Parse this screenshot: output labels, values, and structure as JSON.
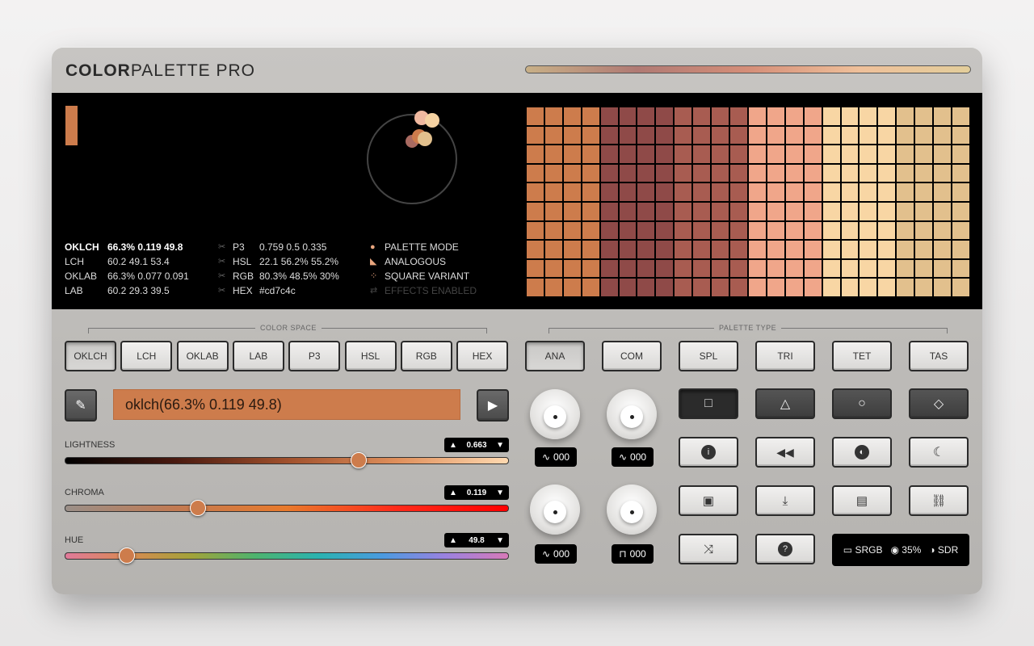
{
  "app": {
    "title_bold": "COLOR",
    "title_light": "PALETTE PRO"
  },
  "colors": {
    "primary": "#cd7c4c"
  },
  "wheel_dots": [
    {
      "color": "#f0b9a0"
    },
    {
      "color": "#f5d2a2"
    },
    {
      "color": "#a96a61"
    },
    {
      "color": "#cd7c4c"
    },
    {
      "color": "#e2c08d"
    }
  ],
  "info": {
    "oklch": {
      "label": "OKLCH",
      "value": "66.3% 0.119 49.8"
    },
    "lch": {
      "label": "LCH",
      "value": "60.2 49.1 53.4"
    },
    "oklab": {
      "label": "OKLAB",
      "value": "66.3% 0.077 0.091"
    },
    "lab": {
      "label": "LAB",
      "value": "60.2 29.3 39.5"
    },
    "p3": {
      "label": "P3",
      "value": "0.759 0.5 0.335"
    },
    "hsl": {
      "label": "HSL",
      "value": "22.1 56.2% 55.2%"
    },
    "rgb": {
      "label": "RGB",
      "value": "80.3% 48.5% 30%"
    },
    "hex": {
      "label": "HEX",
      "value": "#cd7c4c"
    },
    "modes": [
      {
        "label": "PALETTE MODE",
        "icon": "palette-icon"
      },
      {
        "label": "ANALOGOUS",
        "icon": "analogous-icon"
      },
      {
        "label": "SQUARE VARIANT",
        "icon": "square-variant-icon"
      },
      {
        "label": "EFFECTS ENABLED",
        "icon": "effects-icon"
      }
    ]
  },
  "grid": {
    "columns": [
      "#cd7c4c",
      "#cd7c4c",
      "#cd7c4c",
      "#cd7c4c",
      "#8f4a48",
      "#8f4a48",
      "#8f4a48",
      "#8f4a48",
      "#a85c51",
      "#a85c51",
      "#a85c51",
      "#a85c51",
      "#f0a68a",
      "#f0a68a",
      "#f0a68a",
      "#f0a68a",
      "#f8d6a4",
      "#f8d6a4",
      "#f8d6a4",
      "#f8d6a4",
      "#e2c08d",
      "#e2c08d",
      "#e2c08d",
      "#e2c08d"
    ]
  },
  "color_space": {
    "label": "COLOR SPACE",
    "buttons": [
      "OKLCH",
      "LCH",
      "OKLAB",
      "LAB",
      "P3",
      "HSL",
      "RGB",
      "HEX"
    ],
    "active": "OKLCH"
  },
  "palette_type": {
    "label": "PALETTE TYPE",
    "buttons": [
      "ANA",
      "COM",
      "SPL",
      "TRI",
      "TET",
      "TAS"
    ],
    "active": "ANA"
  },
  "input": {
    "value": "oklch(66.3% 0.119 49.8)"
  },
  "sliders": {
    "lightness": {
      "label": "LIGHTNESS",
      "value": "0.663",
      "fraction": 0.663
    },
    "chroma": {
      "label": "CHROMA",
      "value": "0.119",
      "fraction": 0.3
    },
    "hue": {
      "label": "HUE",
      "value": "49.8",
      "fraction": 0.138
    }
  },
  "knobs": [
    {
      "wave": "∿",
      "value": "000"
    },
    {
      "wave": "∿",
      "value": "000"
    },
    {
      "wave": "∿",
      "value": "000"
    },
    {
      "wave": "⊓",
      "value": "000"
    }
  ],
  "shapes": [
    "square-icon",
    "triangle-icon",
    "circle-icon",
    "diamond-icon"
  ],
  "action_icons": [
    [
      "info-icon",
      "rewind-icon",
      "palette-icon",
      "night-mode-icon"
    ],
    [
      "image-icon",
      "download-icon",
      "clipboard-icon",
      "link-icon"
    ],
    [
      "shuffle-icon",
      "help-icon"
    ]
  ],
  "status": {
    "gamut": "SRGB",
    "vision": "35%",
    "range": "SDR"
  }
}
